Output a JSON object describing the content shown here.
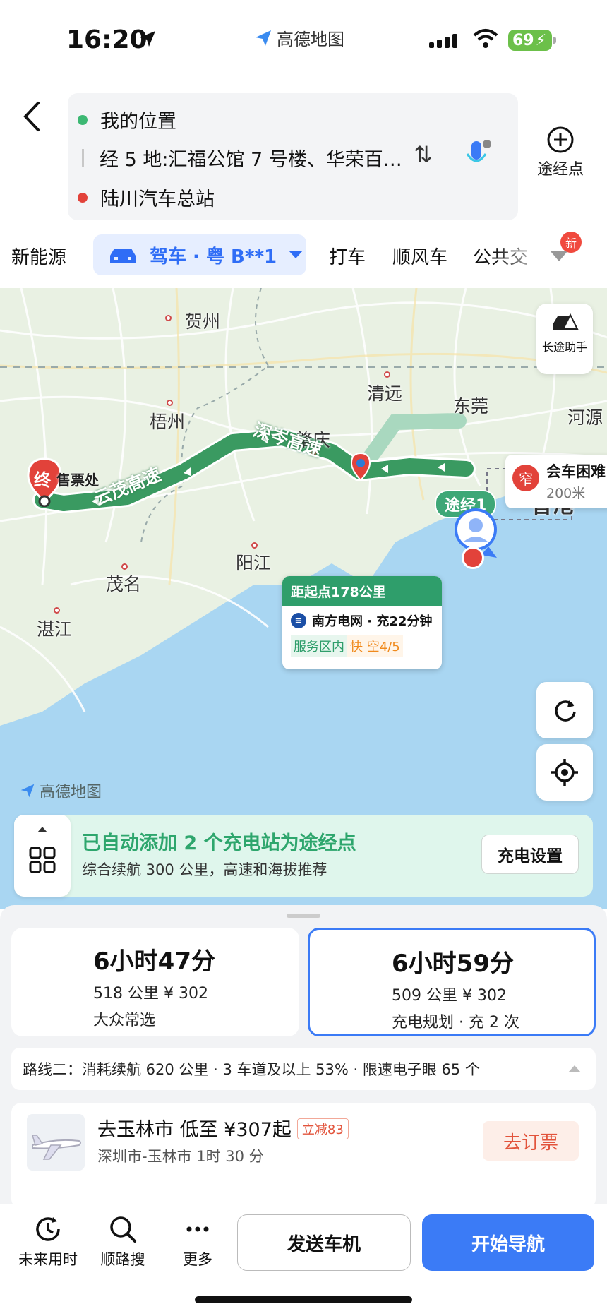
{
  "status_bar": {
    "time": "16:20",
    "app_name": "高德地图",
    "battery": "69"
  },
  "route": {
    "origin": "我的位置",
    "via": "经 5 地:汇福公馆 7 号楼、华荣百…",
    "destination": "陆川汽车总站",
    "add_waypoint_label": "途经点"
  },
  "tabs": {
    "new_energy": "新能源",
    "drive": "驾车 · 粤 B**1",
    "taxi": "打车",
    "carpool": "顺风车",
    "transit": "公共交",
    "new_badge": "新"
  },
  "map": {
    "cities": [
      "贺州",
      "梧州",
      "清远",
      "肇庆",
      "东莞",
      "香港",
      "阳江",
      "茂名",
      "湛江",
      "河源"
    ],
    "roads": [
      "深岑高速",
      "云茂高速"
    ],
    "long_trip_label": "长途助手",
    "via_tag": "途经1",
    "end_tag": "终",
    "ticket_label": "售票处",
    "watermark": "高德地图",
    "warning": {
      "icon": "窄",
      "title": "会车困难",
      "distance": "200米"
    },
    "callout": {
      "distance": "距起点178公里",
      "station": "南方电网 · 充22分钟",
      "tag_area": "服务区内",
      "tag_status": "快 空4/5"
    },
    "banner": {
      "title": "已自动添加 2 个充电站为途经点",
      "subtitle": "综合续航 300 公里，高速和海拔推荐",
      "button": "充电设置"
    }
  },
  "routes": [
    {
      "time": "6小时47分",
      "dist_price": "518 公里 ¥ 302",
      "tag": "大众常选"
    },
    {
      "time": "6小时59分",
      "dist_price": "509 公里 ¥ 302",
      "tag": "充电规划 · 充 2 次"
    }
  ],
  "route_two": "路线二：消耗续航 620 公里 · 3 车道及以上 53% · 限速电子眼 65 个",
  "flight": {
    "title": "去玉林市 低至 ¥307起",
    "discount": "立减83",
    "subtitle": "深圳市-玉林市 1时 30 分",
    "button": "去订票"
  },
  "bottom": {
    "future": "未来用时",
    "along_search": "顺路搜",
    "more": "更多",
    "send": "发送车机",
    "start": "开始导航"
  }
}
